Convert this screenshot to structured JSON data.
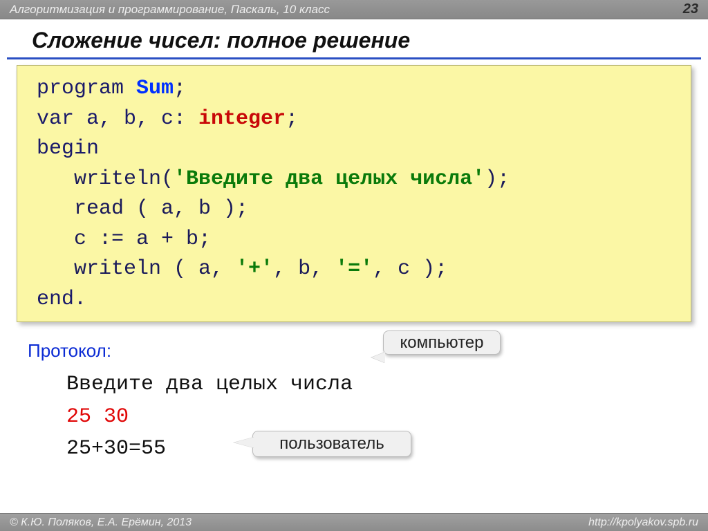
{
  "header": {
    "course": "Алгоритмизация и программирование, Паскаль, 10 класс",
    "page_number": "23"
  },
  "title": "Сложение чисел: полное решение",
  "code": {
    "l1_a": "program ",
    "l1_name": "Sum",
    "l1_b": ";",
    "l2_a": "var a, b, c: ",
    "l2_type": "integer",
    "l2_b": ";",
    "l3": "begin",
    "l4_a": "   writeln(",
    "l4_str": "'Введите два целых числа'",
    "l4_b": ");",
    "l5": "   read ( a, b );",
    "l6": "   c := a + b;",
    "l7_a": "   writeln ( a, ",
    "l7_s1": "'+'",
    "l7_m": ", b, ",
    "l7_s2": "'='",
    "l7_b": ", c );",
    "l8": "end."
  },
  "protocol_label": "Протокол:",
  "protocol": {
    "line1": "Введите два целых числа",
    "line2": "25 30",
    "line3": "25+30=55"
  },
  "callouts": {
    "computer": "компьютер",
    "user": "пользователь"
  },
  "footer": {
    "copyright": "© К.Ю. Поляков, Е.А. Ерёмин, 2013",
    "url": "http://kpolyakov.spb.ru"
  }
}
